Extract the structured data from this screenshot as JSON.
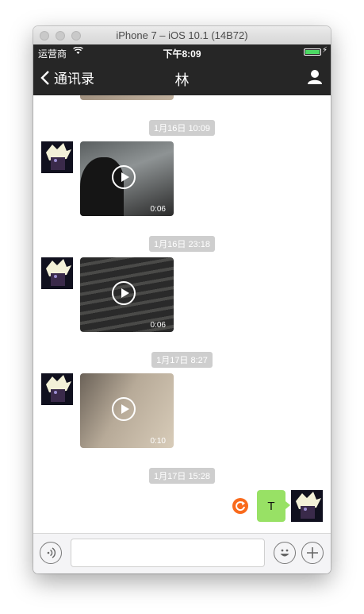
{
  "window": {
    "title": "iPhone 7 – iOS 10.1 (14B72)"
  },
  "status_bar": {
    "carrier": "运营商",
    "time": "下午8:09",
    "battery_level": 1.0
  },
  "nav": {
    "back_label": "通讯录",
    "title": "林"
  },
  "messages": [
    {
      "timestamp": "1月16日 10:09",
      "duration": "0:06"
    },
    {
      "timestamp": "1月16日 23:18",
      "duration": "0:06"
    },
    {
      "timestamp": "1月17日 8:27",
      "duration": "0:10"
    },
    {
      "timestamp": "1月17日 15:28",
      "text": "T"
    }
  ],
  "colors": {
    "nav_bg": "#262626",
    "outgoing_bubble": "#98e165",
    "resend": "#f96a1c",
    "timestamp_bg": "#cecece"
  },
  "icons": [
    "back-chevron-icon",
    "wifi-icon",
    "battery-icon",
    "profile-icon",
    "play-icon",
    "resend-icon",
    "voice-icon",
    "emoji-icon",
    "add-icon"
  ]
}
